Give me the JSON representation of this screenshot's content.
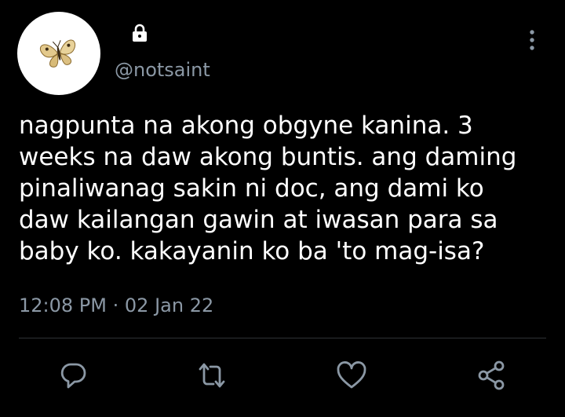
{
  "tweet": {
    "handle": "@notsaint",
    "text": "nagpunta na akong obgyne kanina. 3\nweeks na daw akong buntis. ang daming\npinaliwanag sakin ni doc, ang dami ko\ndaw kailangan gawin at iwasan para sa\nbaby ko. kakayanin ko ba 'to mag-isa?",
    "time": "12:08 PM",
    "separator": "·",
    "date": "02 Jan 22"
  },
  "icons": {
    "avatar": "butterfly-icon",
    "private": "lock-icon",
    "menu": "more-vertical-icon",
    "reply": "reply-icon",
    "retweet": "retweet-icon",
    "like": "heart-icon",
    "share": "share-icon"
  },
  "colors": {
    "background": "#000000",
    "text": "#ffffff",
    "secondary": "#8b98a5",
    "divider": "#2f3336"
  }
}
